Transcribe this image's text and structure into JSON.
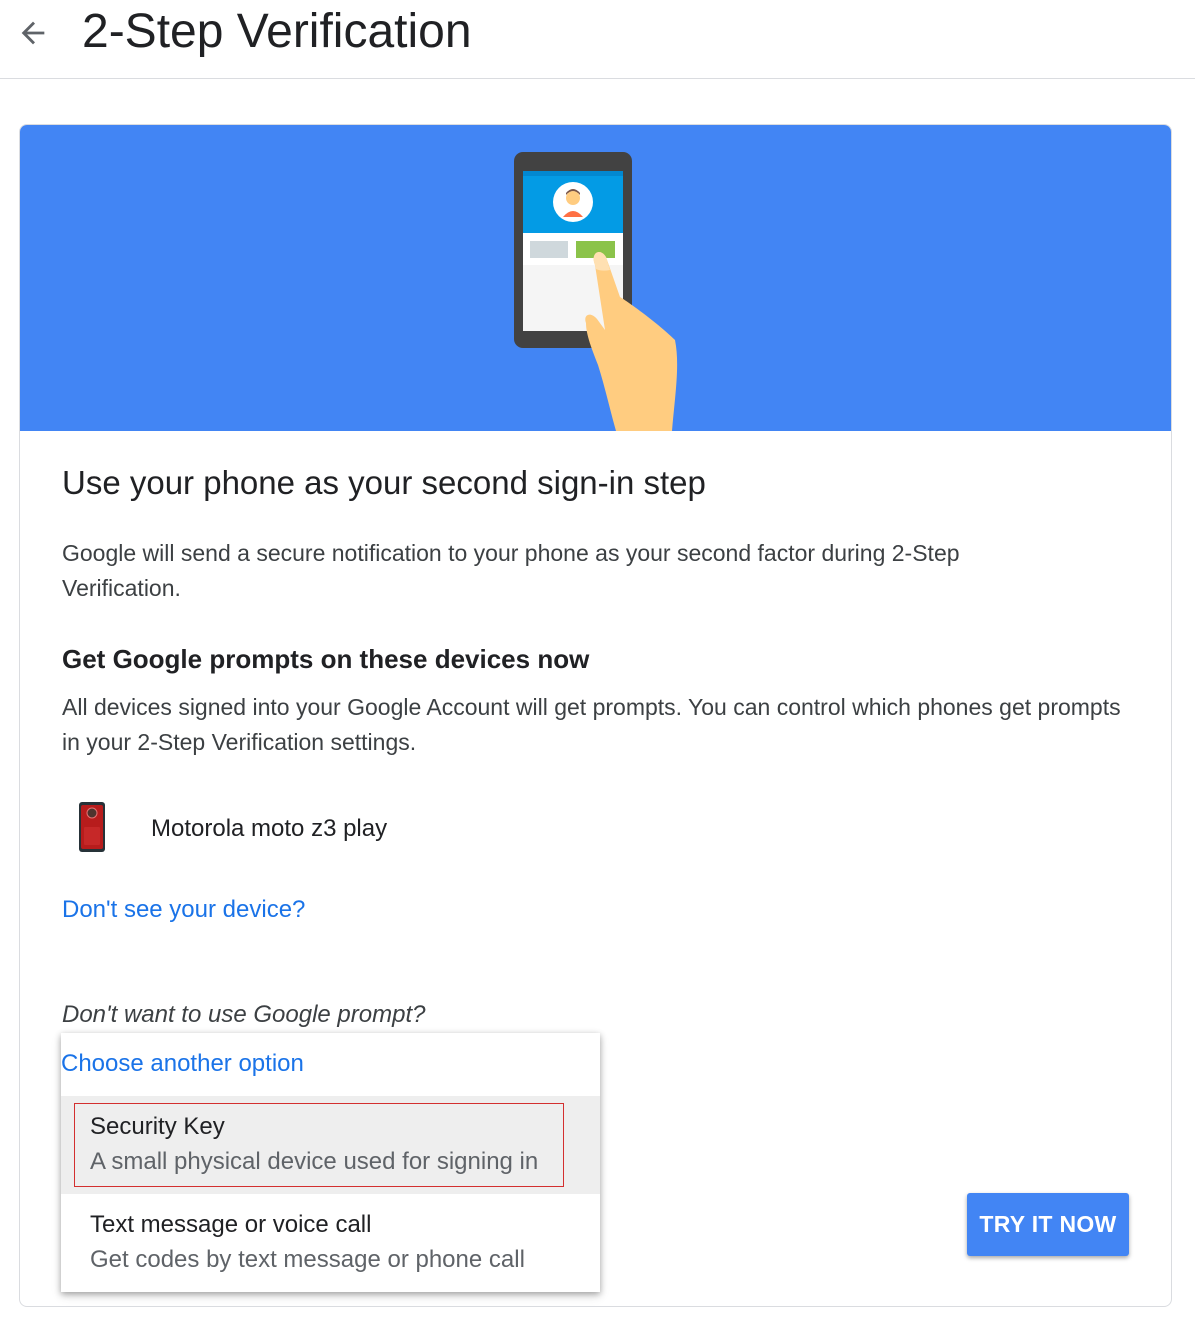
{
  "header": {
    "back_icon": "arrow-back-icon",
    "title": "2-Step Verification"
  },
  "hero": {
    "illustration": "phone-tap-illustration",
    "background_color": "#4285f4"
  },
  "card": {
    "title": "Use your phone as your second sign-in step",
    "description": "Google will send a secure notification to your phone as your second factor during 2-Step Verification.",
    "devices_heading": "Get Google prompts on these devices now",
    "devices_description": "All devices signed into your Google Account will get prompts. You can control which phones get prompts in your 2-Step Verification settings.",
    "device": {
      "icon": "smartphone-icon",
      "name": "Motorola moto z3 play"
    },
    "missing_device_link": "Don't see your device?",
    "alternative_question": "Don't want to use Google prompt?",
    "try_button": "TRY IT NOW"
  },
  "dropdown": {
    "title": "Choose another option",
    "options": [
      {
        "label": "Security Key",
        "sublabel": "A small physical device used for signing in",
        "selected": true
      },
      {
        "label": "Text message or voice call",
        "sublabel": "Get codes by text message or phone call",
        "selected": false
      }
    ]
  },
  "colors": {
    "accent": "#4285f4",
    "link": "#1a73e8",
    "selection_outline": "#d32f2f"
  }
}
